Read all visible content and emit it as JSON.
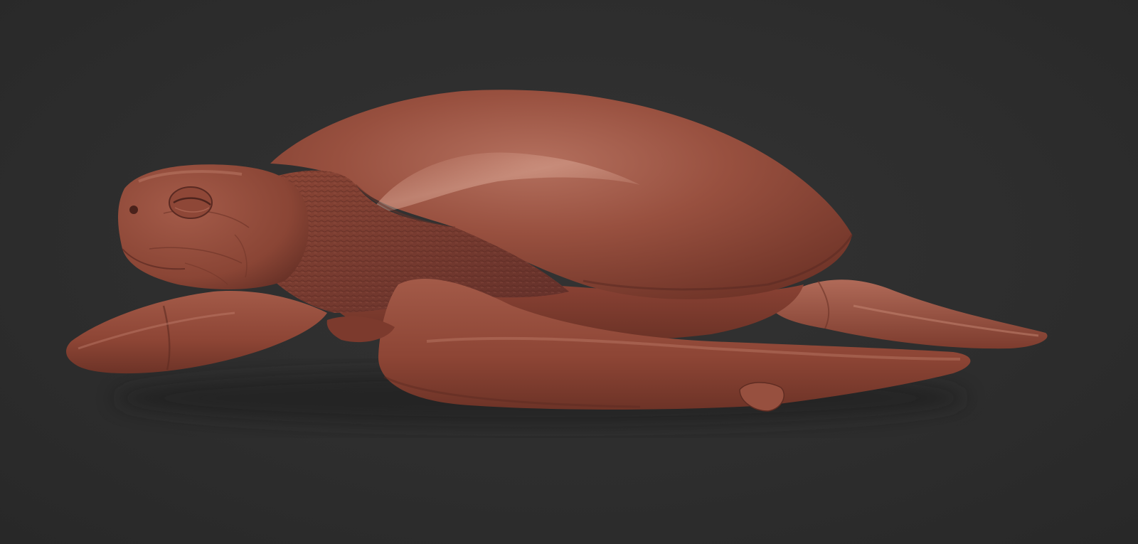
{
  "scene": {
    "subject": "sea-turtle-sculpt",
    "material": "clay",
    "colors": {
      "background": "#2e2e2e",
      "clay_base": "#8c4638",
      "clay_mid": "#9d5343",
      "clay_highlight": "#c98a78",
      "clay_shadow": "#5a2a22",
      "texture_dark": "#6a3127"
    }
  }
}
